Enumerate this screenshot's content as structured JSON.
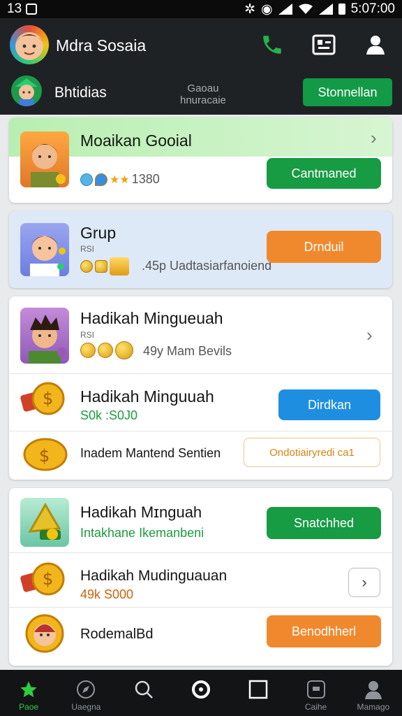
{
  "status_bar": {
    "left_text": "13",
    "time": "5:07:00"
  },
  "header": {
    "title": "Mdra Sosaia",
    "subtitle": "Bhtidias",
    "center_line1": "Gaoau",
    "center_line2": "hnuracaie",
    "action_button": "Stonnellan",
    "icons": [
      "phone-icon",
      "qr-icon",
      "profile-icon"
    ]
  },
  "cards": {
    "c1": {
      "title": "Moaikan Gooial",
      "meta": "1380",
      "button": "Cantmaned"
    },
    "c2": {
      "title": "Grup",
      "small": "RSI",
      "meta": ".45p  Uadtasiarfanoiend",
      "button": "Drnduil"
    },
    "c3": {
      "row1": {
        "title": "Hadikah Mingueuah",
        "small": "RSI",
        "meta": "49y  Mam Bevils"
      },
      "row2": {
        "title": "Hadikah Minguuah",
        "meta": "S0k :S0J0",
        "button": "Dirdkan"
      },
      "row3": {
        "title": "Inadem Mantend Sentien",
        "button": "Ondotiairyredi ca1"
      }
    },
    "c4": {
      "row1": {
        "title": "Hadikah Mɪnguah",
        "meta": "Intakhane Ikemanbeni",
        "button": "Snatchhed"
      },
      "row2": {
        "title": "Hadikah Mudinguauan",
        "meta": "49k S000"
      },
      "row3": {
        "title": "RodemalBd",
        "button": "Benodhherl"
      }
    }
  },
  "nav": [
    {
      "label": "Paoe",
      "icon": "star-icon"
    },
    {
      "label": "Uaegna",
      "icon": "compass-icon"
    },
    {
      "label": "",
      "icon": "search-icon"
    },
    {
      "label": "",
      "icon": "circle-icon"
    },
    {
      "label": "",
      "icon": "square-icon"
    },
    {
      "label": "Caihe",
      "icon": "wallet-icon"
    },
    {
      "label": "Mamago",
      "icon": "person-icon"
    }
  ]
}
